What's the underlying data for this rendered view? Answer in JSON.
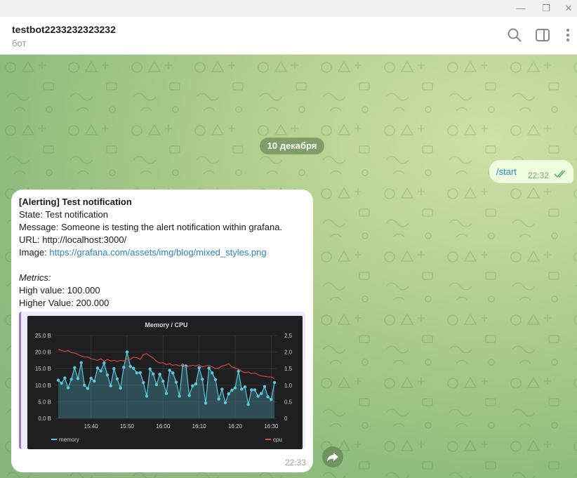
{
  "window": {
    "minimize_glyph": "—",
    "maximize_glyph": "❐",
    "close_glyph": "✕"
  },
  "header": {
    "title": "testbot2233232323232",
    "subtitle": "бот"
  },
  "date_separator": "10 декабря",
  "outgoing": {
    "text": "/start",
    "time": "22:32"
  },
  "incoming": {
    "title": "[Alerting] Test notification",
    "state": "State: Test notification",
    "message": "Message: Someone is testing the alert notification within grafana.",
    "url": "URL: http://localhost:3000/",
    "image_label": "Image: ",
    "image_link": "https://grafana.com/assets/img/blog/mixed_styles.png",
    "metrics_label": "Metrics:",
    "high_value": "High value: 100.000",
    "higher_value": "Higher Value: 200.000",
    "time": "22:33"
  },
  "colors": {
    "accent_link": "#2a83c6",
    "outgoing_bubble": "#effdde",
    "memory_series": "#5bc7dc",
    "cpu_series": "#e0483a"
  },
  "chart_data": {
    "type": "line",
    "title": "Memory / CPU",
    "x_ticks": [
      "15:40",
      "15:50",
      "16:00",
      "16:10",
      "16:20",
      "16:30"
    ],
    "y_left_ticks": [
      "0.0 B",
      "5.0 B",
      "10.0 B",
      "15.0 B",
      "20.0 B",
      "25.0 B"
    ],
    "y_right_ticks": [
      "0",
      "0.5",
      "1.0",
      "1.5",
      "2.0",
      "2.5"
    ],
    "ylim_left": [
      0,
      25
    ],
    "ylim_right": [
      0,
      2.5
    ],
    "legend": "bottom",
    "series": [
      {
        "name": "memory",
        "axis": "left",
        "values": [
          11.5,
          10.6,
          12.2,
          9.2,
          11.8,
          15.3,
          12.0,
          16.8,
          10.0,
          9.0,
          12.1,
          11.2,
          15.2,
          14.3,
          16.7,
          13.1,
          9.8,
          15.0,
          11.9,
          9.1,
          15.4,
          20.0,
          15.7,
          15.1,
          13.7,
          13.8,
          10.8,
          6.7,
          14.9,
          13.4,
          10.2,
          13.3,
          11.2,
          7.5,
          14.5,
          13.7,
          10.9,
          6.7,
          16.0,
          15.8,
          6.9,
          9.8,
          10.4,
          15.3,
          11.8,
          4.6,
          15.2,
          13.7,
          11.7,
          5.8,
          8.8,
          4.7,
          7.4,
          8.5,
          9.2,
          14.2,
          8.8,
          9.5,
          4.2,
          8.6,
          8.6,
          6.7,
          7.5,
          9.6,
          6.5,
          5.7,
          10.8
        ]
      },
      {
        "name": "cpu",
        "axis": "right",
        "values": [
          2.08,
          2.05,
          2.02,
          2.05,
          1.98,
          1.97,
          1.93,
          1.88,
          1.85,
          1.85,
          1.8,
          1.78,
          1.75,
          1.8,
          1.72,
          1.78,
          1.73,
          1.75,
          1.72,
          1.75,
          1.73,
          1.8,
          1.78,
          1.85,
          1.83,
          1.78,
          1.92,
          1.95,
          1.88,
          1.82,
          1.72,
          1.67,
          1.68,
          1.62,
          1.65,
          1.6,
          1.62,
          1.58,
          1.62,
          1.55,
          1.58,
          1.6,
          1.58,
          1.62,
          1.55,
          1.58,
          1.6,
          1.55,
          1.5,
          1.52,
          1.58,
          1.6,
          1.65,
          1.55,
          1.52,
          1.48,
          1.42,
          1.38,
          1.4,
          1.35,
          1.37,
          1.32,
          1.28,
          1.27,
          1.25,
          1.25,
          1.2
        ]
      }
    ]
  }
}
